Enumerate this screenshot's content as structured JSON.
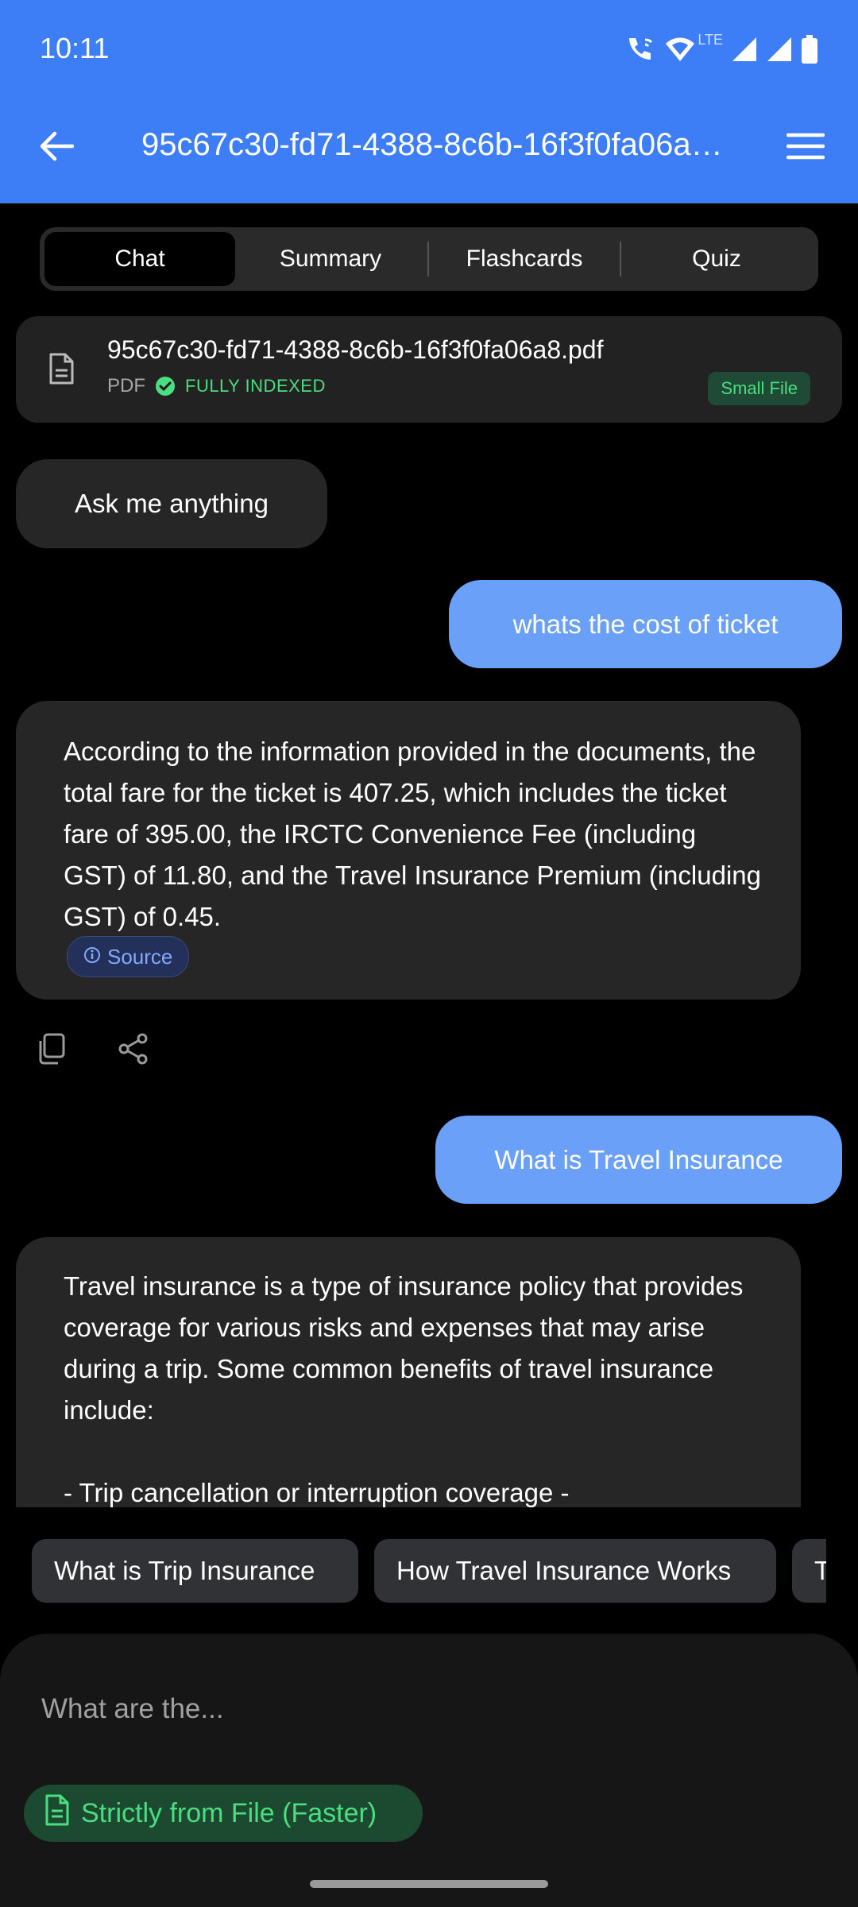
{
  "status_bar": {
    "time": "10:11",
    "network_label": "LTE",
    "icons": [
      "wifi-call-icon",
      "wifi-icon",
      "signal-icon",
      "signal-icon",
      "battery-icon"
    ]
  },
  "header": {
    "title": "95c67c30-fd71-4388-8c6b-16f3f0fa06a8.pdf",
    "back_icon": "arrow-left-icon",
    "menu_icon": "menu-icon",
    "background_color": "#3d7ef7"
  },
  "tabs": [
    {
      "label": "Chat",
      "active": true
    },
    {
      "label": "Summary",
      "active": false
    },
    {
      "label": "Flashcards",
      "active": false
    },
    {
      "label": "Quiz",
      "active": false
    }
  ],
  "file_card": {
    "name": "95c67c30-fd71-4388-8c6b-16f3f0fa06a8.pdf",
    "type": "PDF",
    "index_status": "FULLY INDEXED",
    "size_badge": "Small File",
    "status_color": "#4ade80"
  },
  "chat": {
    "greeting": "Ask me anything",
    "user_message_1": "whats the cost of ticket",
    "bot_answer_1": "According to the information provided in the documents, the total fare for the ticket is 407.25, which includes the ticket fare of 395.00, the IRCTC Convenience Fee (including GST) of 11.80, and the Travel Insurance Premium (including GST) of 0.45.",
    "source_label": "Source",
    "user_message_2": "What is Travel Insurance",
    "bot_answer_2": {
      "paragraph": "Travel insurance is a type of insurance policy that provides coverage for various risks and expenses that may arise during a trip. Some common benefits of travel insurance include:",
      "list_line": "- Trip cancellation or interruption coverage -"
    },
    "user_bubble_color": "#6aa0f7"
  },
  "suggestions": [
    "What is Trip Insurance",
    "How Travel Insurance Works",
    "T"
  ],
  "composer": {
    "placeholder": "What are the...",
    "mode_label": "Strictly from File (Faster)",
    "mode_color": "#4ade80"
  }
}
